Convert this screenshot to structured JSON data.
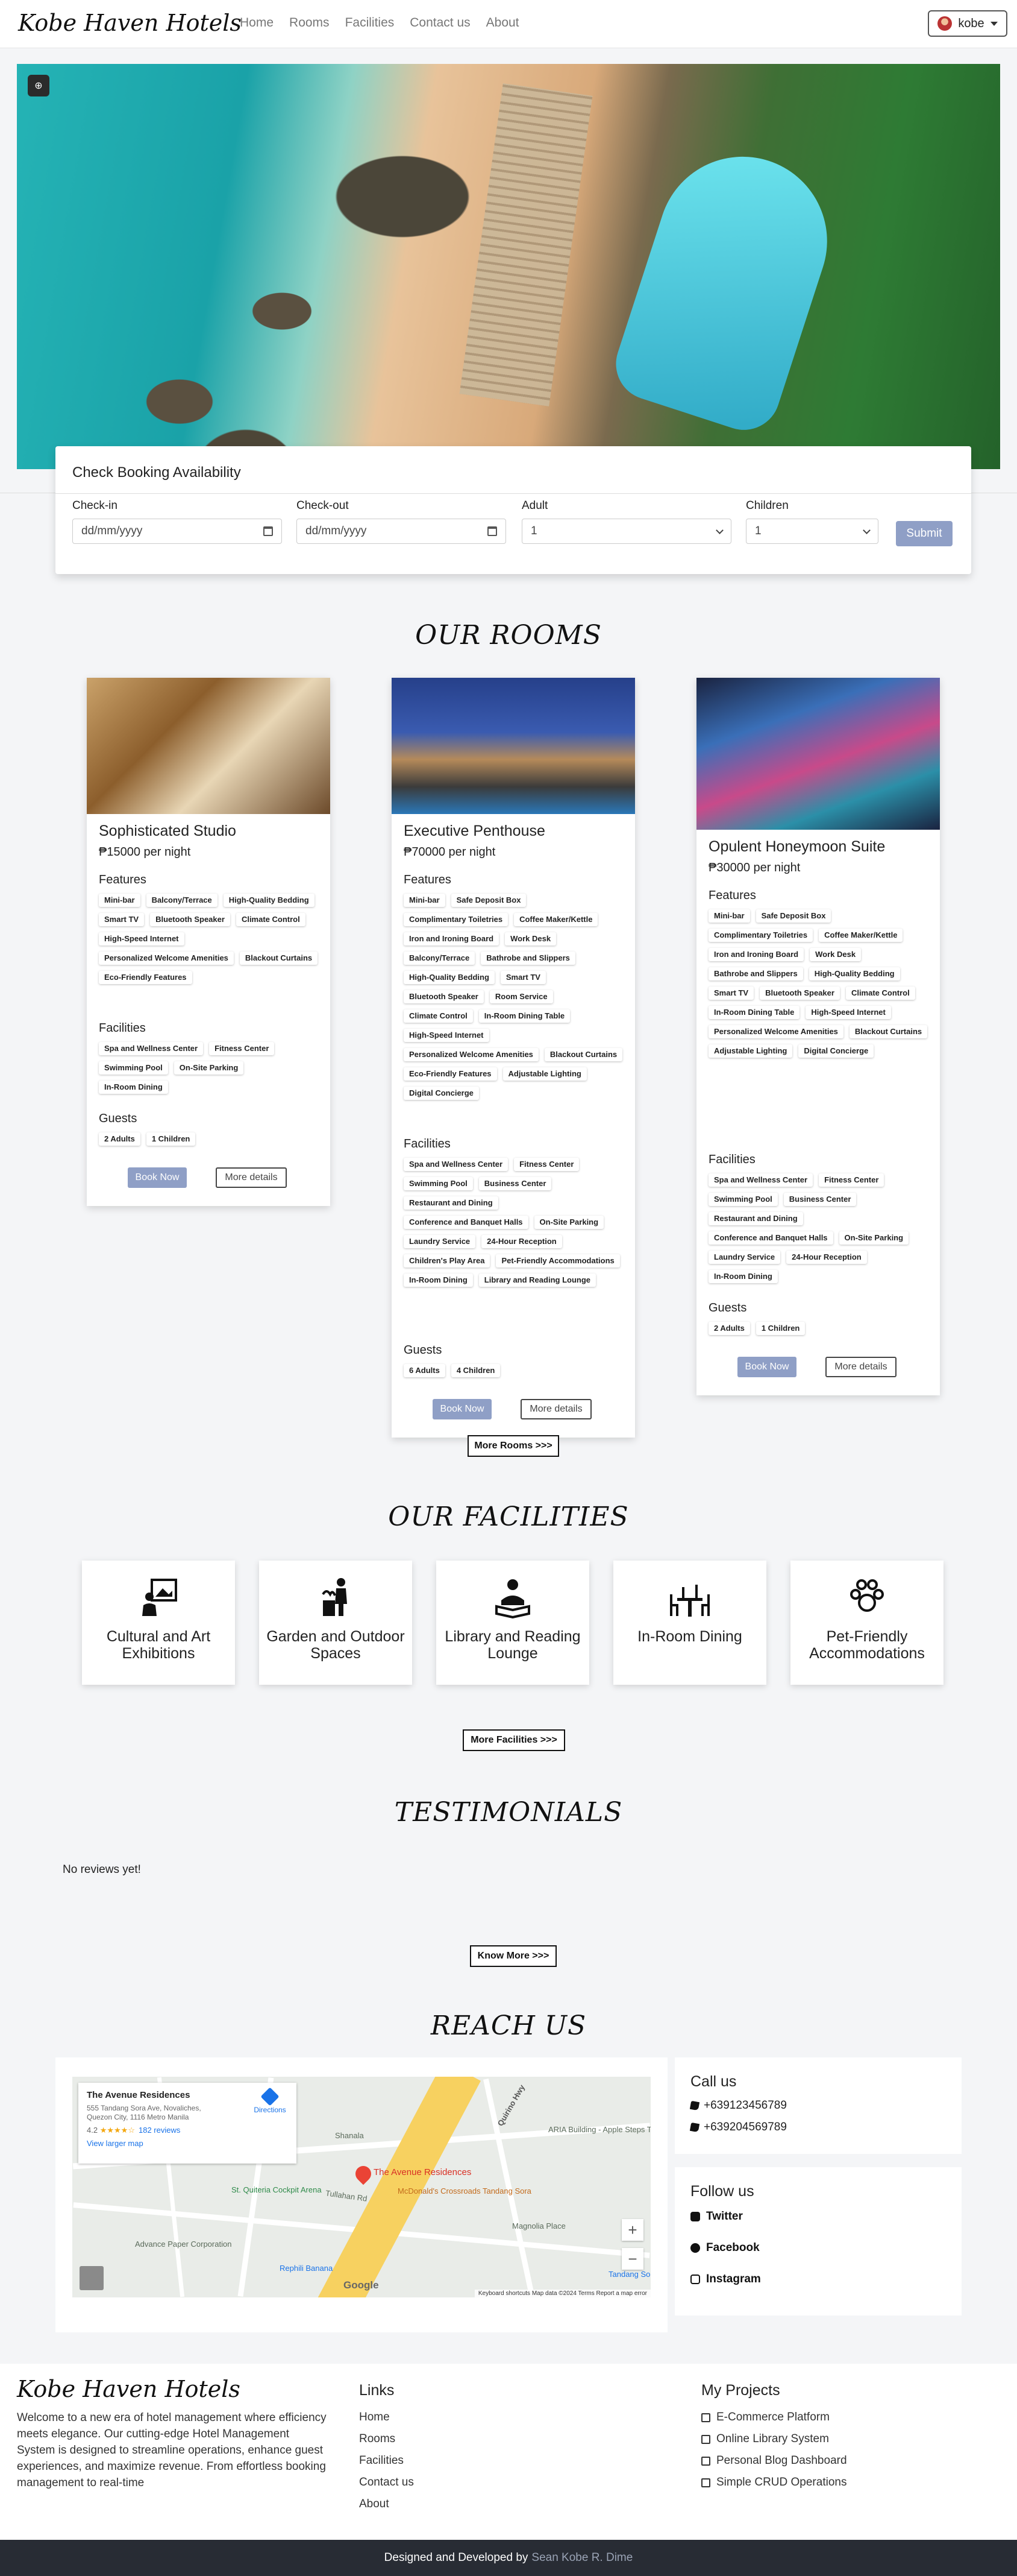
{
  "nav": {
    "brand": "Kobe Haven Hotels",
    "links": [
      "Home",
      "Rooms",
      "Facilities",
      "Contact us",
      "About"
    ],
    "user": "kobe"
  },
  "booking": {
    "title": "Check Booking Availability",
    "checkin_label": "Check-in",
    "checkin_placeholder": "dd/mm/yyyy",
    "checkout_label": "Check-out",
    "checkout_placeholder": "dd/mm/yyyy",
    "adult_label": "Adult",
    "adult_value": "1",
    "children_label": "Children",
    "children_value": "1",
    "submit": "Submit"
  },
  "rooms": {
    "title": "OUR ROOMS",
    "features_label": "Features",
    "facilities_label": "Facilities",
    "guests_label": "Guests",
    "book_label": "Book Now",
    "details_label": "More details",
    "more_label": "More Rooms >>>",
    "items": [
      {
        "name": "Sophisticated Studio",
        "price": "₱15000 per night",
        "features": [
          "Mini-bar",
          "Balcony/Terrace",
          "High-Quality Bedding",
          "Smart TV",
          "Bluetooth Speaker",
          "Climate Control",
          "High-Speed Internet",
          "Personalized Welcome Amenities",
          "Blackout Curtains",
          "Eco-Friendly Features"
        ],
        "facilities": [
          "Spa and Wellness Center",
          "Fitness Center",
          "Swimming Pool",
          "On-Site Parking",
          "In-Room Dining"
        ],
        "guests": [
          "2 Adults",
          "1 Children"
        ]
      },
      {
        "name": "Executive Penthouse",
        "price": "₱70000 per night",
        "features": [
          "Mini-bar",
          "Safe Deposit Box",
          "Complimentary Toiletries",
          "Coffee Maker/Kettle",
          "Iron and Ironing Board",
          "Work Desk",
          "Balcony/Terrace",
          "Bathrobe and Slippers",
          "High-Quality Bedding",
          "Smart TV",
          "Bluetooth Speaker",
          "Room Service",
          "Climate Control",
          "In-Room Dining Table",
          "High-Speed Internet",
          "Personalized Welcome Amenities",
          "Blackout Curtains",
          "Eco-Friendly Features",
          "Adjustable Lighting",
          "Digital Concierge"
        ],
        "facilities": [
          "Spa and Wellness Center",
          "Fitness Center",
          "Swimming Pool",
          "Business Center",
          "Restaurant and Dining",
          "Conference and Banquet Halls",
          "On-Site Parking",
          "Laundry Service",
          "24-Hour Reception",
          "Children's Play Area",
          "Pet-Friendly Accommodations",
          "In-Room Dining",
          "Library and Reading Lounge"
        ],
        "guests": [
          "6 Adults",
          "4 Children"
        ]
      },
      {
        "name": "Opulent Honeymoon Suite",
        "price": "₱30000 per night",
        "features": [
          "Mini-bar",
          "Safe Deposit Box",
          "Complimentary Toiletries",
          "Coffee Maker/Kettle",
          "Iron and Ironing Board",
          "Work Desk",
          "Bathrobe and Slippers",
          "High-Quality Bedding",
          "Smart TV",
          "Bluetooth Speaker",
          "Climate Control",
          "In-Room Dining Table",
          "High-Speed Internet",
          "Personalized Welcome Amenities",
          "Blackout Curtains",
          "Adjustable Lighting",
          "Digital Concierge"
        ],
        "facilities": [
          "Spa and Wellness Center",
          "Fitness Center",
          "Swimming Pool",
          "Business Center",
          "Restaurant and Dining",
          "Conference and Banquet Halls",
          "On-Site Parking",
          "Laundry Service",
          "24-Hour Reception",
          "In-Room Dining"
        ],
        "guests": [
          "2 Adults",
          "1 Children"
        ]
      }
    ]
  },
  "facilities": {
    "title": "OUR FACILITIES",
    "items": [
      {
        "name": "Cultural and Art Exhibitions",
        "icon": "art-gallery-icon"
      },
      {
        "name": "Garden and Outdoor Spaces",
        "icon": "gardener-icon"
      },
      {
        "name": "Library and Reading Lounge",
        "icon": "reading-icon"
      },
      {
        "name": "In-Room Dining",
        "icon": "dining-table-icon"
      },
      {
        "name": "Pet-Friendly Accommodations",
        "icon": "paw-icon"
      }
    ],
    "more_label": "More Facilities >>>"
  },
  "testimonials": {
    "title": "TESTIMONIALS",
    "empty": "No reviews yet!",
    "more_label": "Know More >>>"
  },
  "reach": {
    "title": "REACH US",
    "map": {
      "place": "The Avenue Residences",
      "address": "555 Tandang Sora Ave, Novaliches, Quezon City, 1116 Metro Manila",
      "rating": "4.2",
      "stars": "★★★★☆",
      "reviews": "182 reviews",
      "larger_map": "View larger map",
      "directions": "Directions",
      "pin_label": "The Avenue Residences",
      "labels": [
        "Quirino Hwy",
        "St. Quiteria Cockpit Arena",
        "McDonald's Crossroads Tandang Sora",
        "Magnolia Place",
        "Advance Paper Corporation",
        "Rephili Banana",
        "ARIA Building - Apple Steps The Junction Place",
        "Tullahan Rd",
        "Shanala",
        "Tandang Sora"
      ],
      "footer": "Keyboard shortcuts   Map data ©2024   Terms   Report a map error",
      "google": "Google"
    },
    "call_title": "Call us",
    "phones": [
      "+639123456789",
      "+639204569789"
    ],
    "follow_title": "Follow us",
    "socials": [
      "Twitter",
      "Facebook",
      "Instagram"
    ]
  },
  "footer": {
    "brand": "Kobe Haven Hotels",
    "description": "Welcome to a new era of hotel management where efficiency meets elegance. Our cutting-edge Hotel Management System is designed to streamline operations, enhance guest experiences, and maximize revenue. From effortless booking management to real-time",
    "links_title": "Links",
    "links": [
      "Home",
      "Rooms",
      "Facilities",
      "Contact us",
      "About"
    ],
    "projects_title": "My Projects",
    "projects": [
      "E-Commerce Platform",
      "Online Library System",
      "Personal Blog Dashboard",
      "Simple CRUD Operations"
    ],
    "credit_prefix": "Designed and Developed by",
    "credit_name": "Sean Kobe R. Dime"
  }
}
